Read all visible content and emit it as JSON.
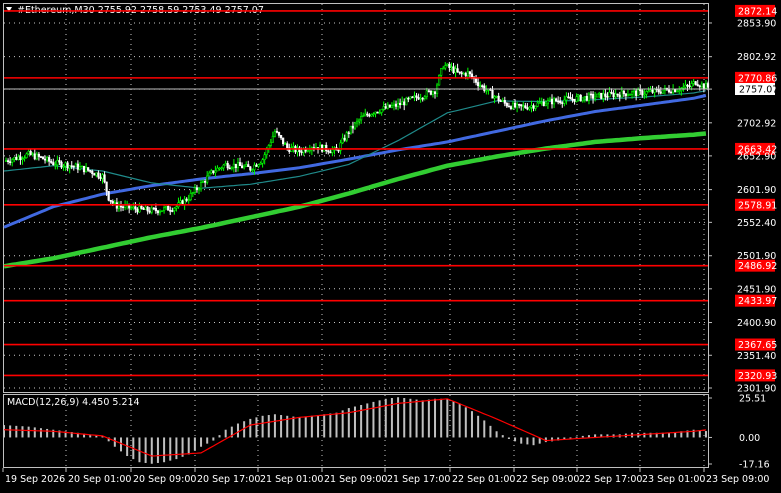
{
  "chart_header": {
    "title": "#Ethereum,M30  2755.92 2758.59 2753.49 2757.07",
    "icon": "triangle-down-icon"
  },
  "macd_header": {
    "title": "MACD(12,26,9) 4.450 5.214"
  },
  "colors": {
    "background": "#000000",
    "bull_candle": "#00ff00",
    "bear_candle": "#ffffff",
    "level": "#ff0000",
    "ma_fast": "#1f8a8a",
    "ma_mid": "#4169e1",
    "ma_slow": "#32cd32",
    "macd_hist": "#c0c0c0",
    "macd_signal": "#ff0000"
  },
  "chart_data": [
    {
      "type": "candlestick",
      "symbol": "#Ethereum",
      "timeframe": "M30",
      "ohlc": {
        "open": 2755.92,
        "high": 2758.59,
        "low": 2753.49,
        "close": 2757.07
      },
      "current_price": "2757.07",
      "ylim": [
        2301.9,
        2872.0
      ],
      "y_ticks": [
        "2853.90",
        "2802.92",
        "2753.90",
        "2702.92",
        "2652.90",
        "2601.90",
        "2552.40",
        "2501.90",
        "2451.90",
        "2400.90",
        "2351.40",
        "2301.90"
      ],
      "x_ticks": [
        "19 Sep 2026",
        "20 Sep 01:00",
        "20 Sep 09:00",
        "20 Sep 17:00",
        "21 Sep 01:00",
        "21 Sep 09:00",
        "21 Sep 17:00",
        "22 Sep 01:00",
        "22 Sep 09:00",
        "22 Sep 17:00",
        "23 Sep 01:00",
        "23 Sep 09:00"
      ],
      "levels": [
        "2872.14",
        "2770.86",
        "2663.42",
        "2578.91",
        "2486.92",
        "2433.97",
        "2367.65",
        "2320.93"
      ],
      "price_path": [
        [
          0,
          2645
        ],
        [
          6,
          2650
        ],
        [
          12,
          2655
        ],
        [
          18,
          2650
        ],
        [
          24,
          2642
        ],
        [
          30,
          2640
        ],
        [
          36,
          2636
        ],
        [
          42,
          2630
        ],
        [
          48,
          2622
        ],
        [
          51,
          2590
        ],
        [
          54,
          2578
        ],
        [
          60,
          2575
        ],
        [
          66,
          2572
        ],
        [
          72,
          2570
        ],
        [
          78,
          2572
        ],
        [
          84,
          2576
        ],
        [
          90,
          2590
        ],
        [
          96,
          2610
        ],
        [
          102,
          2630
        ],
        [
          108,
          2640
        ],
        [
          114,
          2638
        ],
        [
          120,
          2634
        ],
        [
          126,
          2648
        ],
        [
          132,
          2690
        ],
        [
          138,
          2665
        ],
        [
          144,
          2660
        ],
        [
          150,
          2668
        ],
        [
          156,
          2664
        ],
        [
          162,
          2660
        ],
        [
          168,
          2690
        ],
        [
          174,
          2710
        ],
        [
          180,
          2720
        ],
        [
          186,
          2725
        ],
        [
          192,
          2730
        ],
        [
          198,
          2738
        ],
        [
          204,
          2745
        ],
        [
          210,
          2752
        ],
        [
          214,
          2790
        ],
        [
          218,
          2785
        ],
        [
          222,
          2776
        ],
        [
          226,
          2778
        ],
        [
          232,
          2760
        ],
        [
          238,
          2745
        ],
        [
          244,
          2732
        ],
        [
          250,
          2726
        ],
        [
          256,
          2728
        ],
        [
          262,
          2733
        ],
        [
          268,
          2736
        ],
        [
          274,
          2738
        ],
        [
          280,
          2740
        ],
        [
          286,
          2742
        ],
        [
          292,
          2744
        ],
        [
          298,
          2746
        ],
        [
          304,
          2748
        ],
        [
          310,
          2748
        ],
        [
          316,
          2750
        ],
        [
          322,
          2752
        ],
        [
          328,
          2754
        ],
        [
          334,
          2758
        ],
        [
          337,
          2765
        ],
        [
          340,
          2760
        ],
        [
          343,
          2757
        ]
      ],
      "ma_fast": [
        [
          0,
          2630
        ],
        [
          24,
          2638
        ],
        [
          48,
          2630
        ],
        [
          72,
          2612
        ],
        [
          96,
          2604
        ],
        [
          120,
          2610
        ],
        [
          144,
          2622
        ],
        [
          168,
          2640
        ],
        [
          192,
          2676
        ],
        [
          216,
          2718
        ],
        [
          240,
          2736
        ],
        [
          264,
          2735
        ],
        [
          288,
          2738
        ],
        [
          312,
          2742
        ],
        [
          336,
          2748
        ],
        [
          343,
          2752
        ]
      ],
      "ma_mid": [
        [
          0,
          2545
        ],
        [
          24,
          2576
        ],
        [
          48,
          2595
        ],
        [
          72,
          2608
        ],
        [
          96,
          2618
        ],
        [
          120,
          2626
        ],
        [
          144,
          2635
        ],
        [
          168,
          2648
        ],
        [
          192,
          2662
        ],
        [
          216,
          2674
        ],
        [
          240,
          2690
        ],
        [
          264,
          2706
        ],
        [
          288,
          2720
        ],
        [
          312,
          2730
        ],
        [
          336,
          2740
        ],
        [
          343,
          2745
        ]
      ],
      "ma_slow": [
        [
          0,
          2486
        ],
        [
          24,
          2498
        ],
        [
          48,
          2514
        ],
        [
          72,
          2530
        ],
        [
          96,
          2544
        ],
        [
          120,
          2560
        ],
        [
          144,
          2576
        ],
        [
          168,
          2596
        ],
        [
          192,
          2618
        ],
        [
          216,
          2638
        ],
        [
          240,
          2652
        ],
        [
          264,
          2664
        ],
        [
          288,
          2674
        ],
        [
          312,
          2680
        ],
        [
          336,
          2685
        ],
        [
          343,
          2687
        ]
      ]
    },
    {
      "type": "histogram-line",
      "name": "MACD(12,26,9)",
      "macd_value": "4.450",
      "signal_value": "5.214",
      "ylim": [
        -17.16,
        25.51
      ],
      "y_ticks": [
        "25.51",
        "0.00",
        "-17.16"
      ],
      "histogram": [
        [
          0,
          8
        ],
        [
          12,
          7
        ],
        [
          24,
          5
        ],
        [
          36,
          3
        ],
        [
          48,
          1
        ],
        [
          54,
          -6
        ],
        [
          60,
          -12
        ],
        [
          66,
          -16
        ],
        [
          72,
          -17
        ],
        [
          78,
          -16
        ],
        [
          84,
          -14
        ],
        [
          90,
          -11
        ],
        [
          96,
          -6
        ],
        [
          102,
          -2
        ],
        [
          108,
          5
        ],
        [
          114,
          9
        ],
        [
          120,
          12
        ],
        [
          126,
          14
        ],
        [
          132,
          15
        ],
        [
          138,
          14
        ],
        [
          144,
          13
        ],
        [
          150,
          14
        ],
        [
          156,
          15
        ],
        [
          162,
          16
        ],
        [
          168,
          19
        ],
        [
          174,
          21
        ],
        [
          180,
          23
        ],
        [
          186,
          25
        ],
        [
          192,
          26
        ],
        [
          198,
          25
        ],
        [
          204,
          24
        ],
        [
          210,
          25
        ],
        [
          216,
          25
        ],
        [
          222,
          22
        ],
        [
          228,
          17
        ],
        [
          234,
          11
        ],
        [
          240,
          4
        ],
        [
          246,
          -1
        ],
        [
          252,
          -4
        ],
        [
          258,
          -5
        ],
        [
          264,
          -3
        ],
        [
          270,
          -2
        ],
        [
          276,
          0
        ],
        [
          282,
          1
        ],
        [
          288,
          2
        ],
        [
          294,
          2
        ],
        [
          300,
          2
        ],
        [
          306,
          3
        ],
        [
          312,
          3
        ],
        [
          318,
          3
        ],
        [
          324,
          3
        ],
        [
          330,
          4
        ],
        [
          336,
          5
        ],
        [
          343,
          4
        ]
      ],
      "signal": [
        [
          0,
          5
        ],
        [
          24,
          4
        ],
        [
          48,
          1
        ],
        [
          72,
          -12
        ],
        [
          96,
          -10
        ],
        [
          120,
          8
        ],
        [
          144,
          13
        ],
        [
          168,
          16
        ],
        [
          192,
          22
        ],
        [
          216,
          25
        ],
        [
          240,
          12
        ],
        [
          264,
          -2
        ],
        [
          288,
          0
        ],
        [
          312,
          2
        ],
        [
          336,
          4
        ],
        [
          343,
          5
        ]
      ]
    }
  ]
}
